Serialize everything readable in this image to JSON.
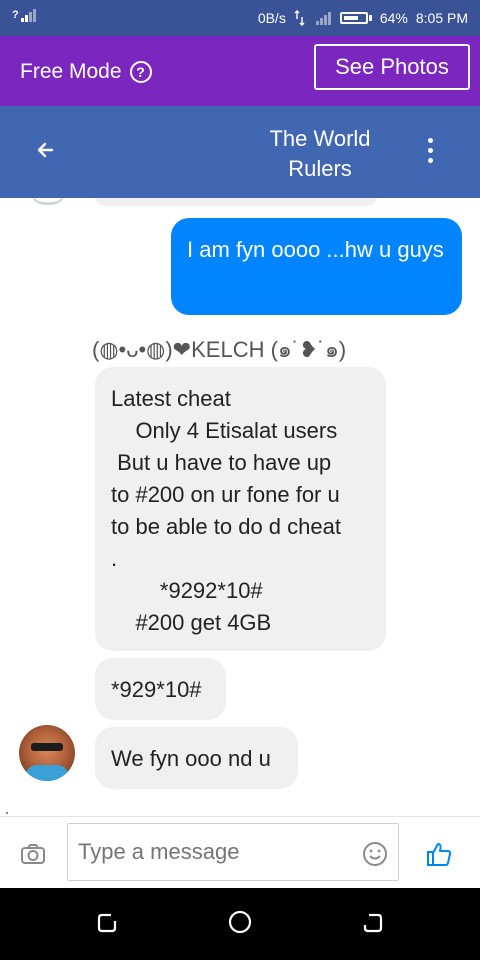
{
  "status_bar": {
    "signal": "?",
    "network_speed": "0B/s",
    "battery_percent": "64%",
    "time": "8:05 PM"
  },
  "free_mode": {
    "label": "Free Mode",
    "help_icon": "help-circle-icon",
    "see_photos_label": "See Photos",
    "bg_color": "#7b26bf"
  },
  "header": {
    "title_line1": "The World",
    "title_line2": "Rulers",
    "back_icon": "arrow-left-icon",
    "menu_icon": "more-vertical-icon",
    "bg_color": "#4267b2"
  },
  "messages": [
    {
      "from": "me",
      "text": "I am fyn oooo ...hw u guys"
    },
    {
      "from": "other",
      "sender": "(◍•ᴗ•◍)❤KELCH (๑˙❥˙๑)",
      "text": "Latest cheat\n    Only 4 Etisalat users\n But u have to have up\nto #200 on ur fone for u\nto be able to do d cheat\n.\n        *9292*10#\n    #200 get 4GB"
    },
    {
      "from": "other",
      "text": "*929*10#"
    },
    {
      "from": "other",
      "text": "We fyn ooo nd u"
    }
  ],
  "composer": {
    "placeholder": "Type a message",
    "camera_icon": "camera-icon",
    "emoji_icon": "emoji-icon",
    "like_icon": "thumbs-up-icon",
    "accent_color": "#0084ff"
  },
  "nav": {
    "recent_icon": "recent-apps-icon",
    "home_icon": "home-icon",
    "back_icon": "back-icon"
  }
}
